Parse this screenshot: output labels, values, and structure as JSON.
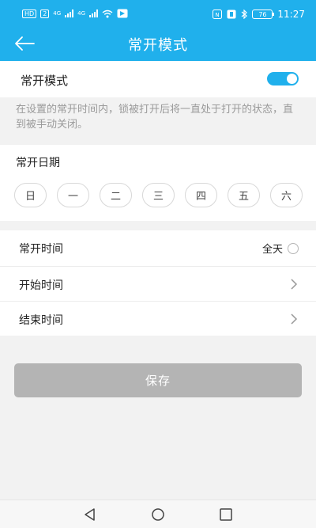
{
  "status_bar": {
    "left_badges": [
      "HD",
      "2"
    ],
    "signal_labels": [
      "4G",
      "4G"
    ],
    "battery": "76",
    "time": "11:27"
  },
  "header": {
    "title": "常开模式",
    "back_icon": "arrow-left-icon"
  },
  "mode_toggle": {
    "label": "常开模式",
    "enabled": true
  },
  "description": "在设置的常开时间内，锁被打开后将一直处于打开的状态，直到被手动关闭。",
  "days": {
    "label": "常开日期",
    "items": [
      "日",
      "一",
      "二",
      "三",
      "四",
      "五",
      "六"
    ]
  },
  "time": {
    "label": "常开时间",
    "all_day_label": "全天",
    "start_label": "开始时间",
    "end_label": "结束时间"
  },
  "save_label": "保存",
  "colors": {
    "accent": "#20b0ec",
    "button_disabled": "#b4b4b4"
  }
}
